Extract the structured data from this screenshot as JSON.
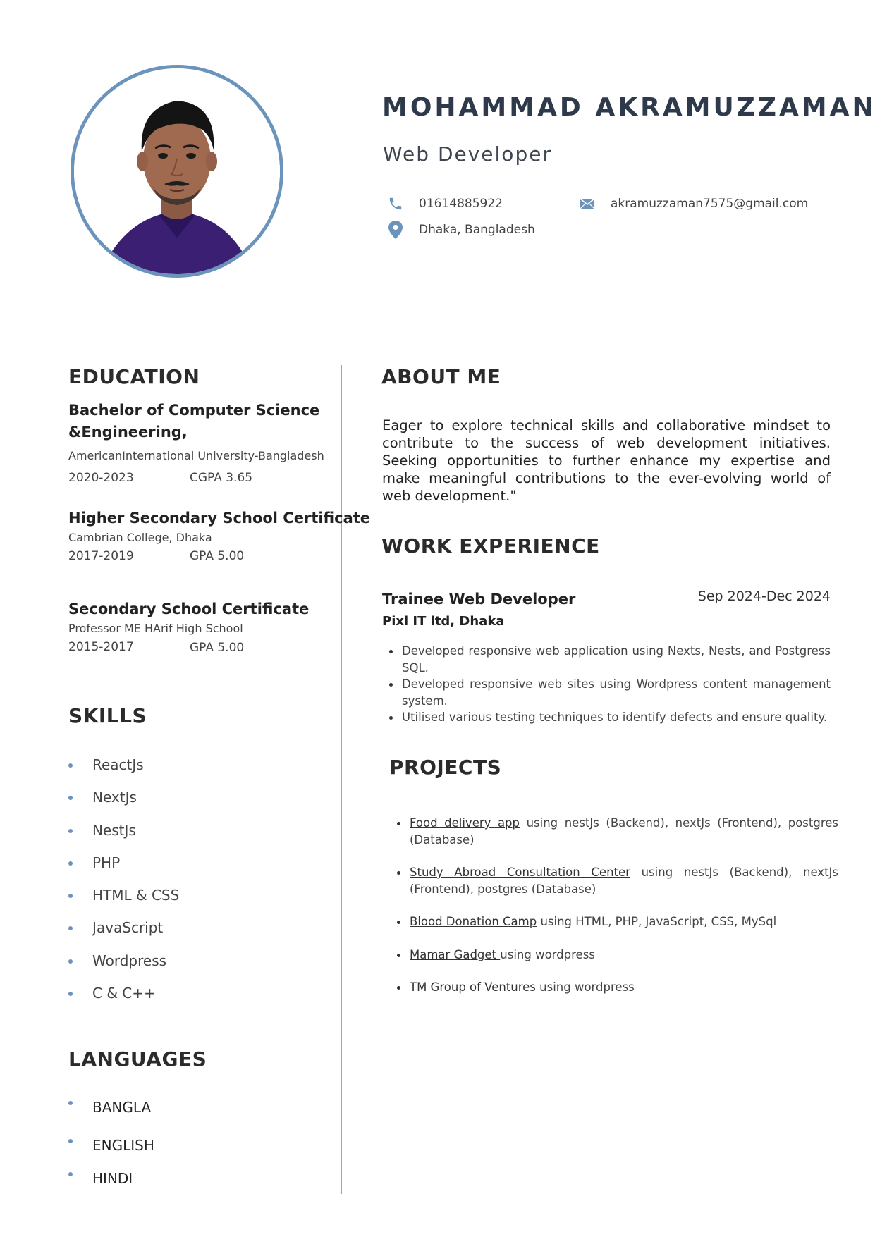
{
  "header": {
    "name": "MOHAMMAD AKRAMUZZAMAN",
    "role": "Web Developer",
    "phone": "01614885922",
    "email": "akramuzzaman7575@gmail.com",
    "location": "Dhaka, Bangladesh",
    "icons": {
      "phone": "phone-icon",
      "email": "envelope-icon",
      "location": "map-pin-icon"
    },
    "accent_color": "#6b94bd"
  },
  "education": {
    "heading": "EDUCATION",
    "items": [
      {
        "title": "Bachelor of Computer Science &Engineering,",
        "institution": "AmericanInternational University-Bangladesh",
        "years": "2020-2023",
        "grade": "CGPA 3.65"
      },
      {
        "title": "Higher Secondary School Certificate",
        "institution": "Cambrian College, Dhaka",
        "years": "2017-2019",
        "grade": "GPA 5.00"
      },
      {
        "title": "Secondary School Certificate",
        "institution": "Professor ME HArif High School",
        "years": "2015-2017",
        "grade": "GPA 5.00"
      }
    ]
  },
  "skills": {
    "heading": "SKILLS",
    "items": [
      "ReactJs",
      "NextJs",
      "NestJs",
      "PHP",
      "HTML & CSS",
      "JavaScript",
      "Wordpress",
      "C & C++"
    ]
  },
  "languages": {
    "heading": "LANGUAGES",
    "items": [
      "BANGLA",
      "ENGLISH",
      "HINDI"
    ]
  },
  "about": {
    "heading": "ABOUT ME",
    "text": "Eager to explore technical skills and collaborative mindset to contribute to the success of web development initiatives. Seeking opportunities to further enhance my expertise and make meaningful contributions to the ever-evolving world of web development.\""
  },
  "work": {
    "heading": "WORK EXPERIENCE",
    "job_title": "Trainee Web Developer",
    "dates": "Sep 2024-Dec 2024",
    "company": "Pixl IT ltd, Dhaka",
    "bullets": [
      "Developed responsive web application using Nexts, Nests, and Postgress SQL.",
      "Developed responsive web sites using Wordpress content management system.",
      "Utilised various testing techniques to identify defects and ensure quality."
    ]
  },
  "projects": {
    "heading": "PROJECTS",
    "items": [
      {
        "link": "Food delivery app",
        "desc": " using nestJs (Backend), nextJs (Frontend), postgres (Database)"
      },
      {
        "link": "Study Abroad Consultation Center",
        "desc": " using nestJs (Backend), nextJs (Frontend), postgres (Database)"
      },
      {
        "link": "Blood Donation Camp",
        "desc": " using HTML, PHP, JavaScript, CSS, MySql"
      },
      {
        "link": "Mamar Gadget ",
        "desc": "using wordpress"
      },
      {
        "link": "TM Group of Ventures",
        "desc": " using wordpress"
      }
    ]
  }
}
